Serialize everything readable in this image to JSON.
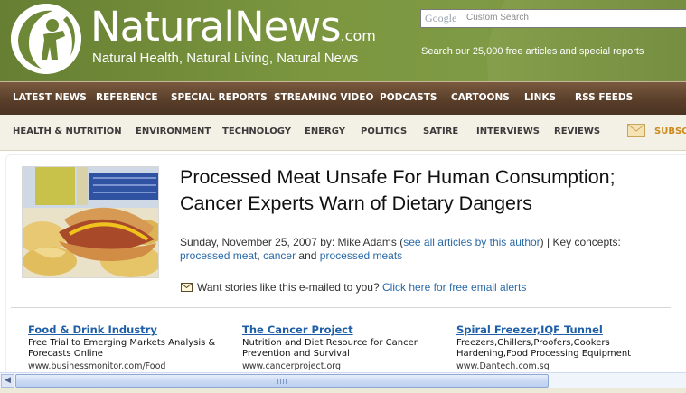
{
  "header": {
    "brand_name": "NaturalNews",
    "brand_suffix": ".com",
    "tagline": "Natural Health, Natural Living, Natural News",
    "search_provider": "Google",
    "search_placeholder": "Custom Search",
    "search_note": "Search our 25,000 free articles and special reports"
  },
  "nav_primary": [
    "LATEST NEWS",
    "REFERENCE",
    "SPECIAL REPORTS",
    "STREAMING VIDEO",
    "PODCASTS",
    "CARTOONS",
    "LINKS",
    "RSS FEEDS"
  ],
  "nav_secondary": [
    "HEALTH & NUTRITION",
    "ENVIRONMENT",
    "TECHNOLOGY",
    "ENERGY",
    "POLITICS",
    "SATIRE",
    "INTERVIEWS",
    "REVIEWS"
  ],
  "subscribe_label": "SUBSC",
  "article": {
    "headline": "Processed Meat Unsafe For Human Consumption; Cancer Experts Warn of Dietary Dangers",
    "date_by": "Sunday, November 25, 2007 by: Mike Adams (",
    "see_all_link": "see all articles by this author",
    "key_concepts_prefix": ") | Key concepts:",
    "concept_1": "processed meat",
    "sep_1": ", ",
    "concept_2": "cancer",
    "sep_2": " and ",
    "concept_3": "processed meats",
    "email_prompt": "Want stories like this e-mailed to you?",
    "email_link": "Click here for free email alerts"
  },
  "ads": [
    {
      "title": "Food & Drink Industry",
      "desc": "Free Trial to Emerging Markets Analysis & Forecasts Online",
      "url": "www.businessmonitor.com/Food"
    },
    {
      "title": "The Cancer Project",
      "desc": "Nutrition and Diet Resource for Cancer Prevention and Survival",
      "url": "www.cancerproject.org"
    },
    {
      "title": "Spiral Freezer,IQF Tunnel",
      "desc": "Freezers,Chillers,Proofers,Cookers Hardening,Food Processing Equipment",
      "url": "www.Dantech.com.sg"
    }
  ],
  "colors": {
    "header_green": "#6f8a3a",
    "nav_brown": "#5a3f2a",
    "link_blue": "#2a6aa8",
    "ad_title_blue": "#1f5fa7",
    "subscribe_orange": "#cc8a1a"
  },
  "icons": {
    "logo": "person-silhouette-logo",
    "email": "envelope-icon",
    "scroll_left": "arrow-left-icon",
    "scroll_right": "arrow-right-icon"
  }
}
